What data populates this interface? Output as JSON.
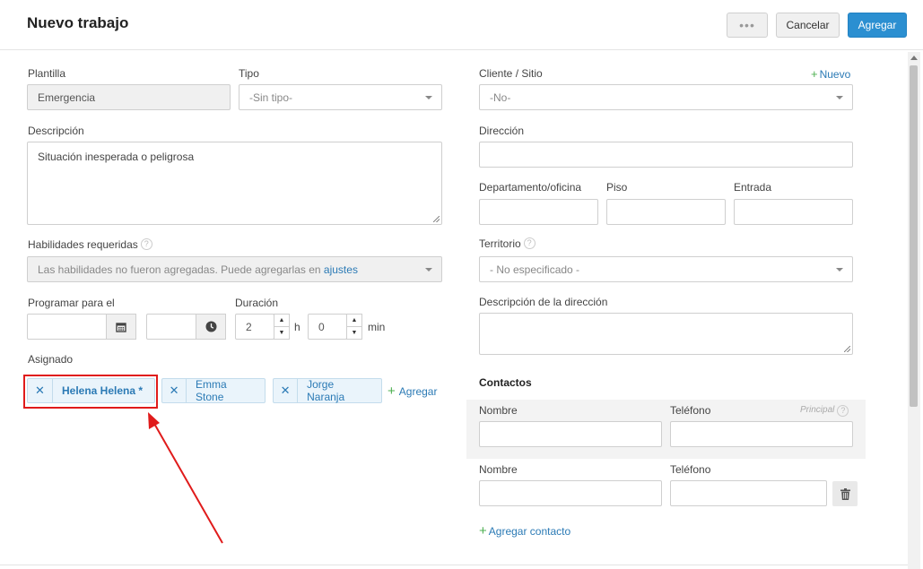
{
  "header": {
    "title": "Nuevo trabajo",
    "more_label": "•••",
    "cancel_label": "Cancelar",
    "add_label": "Agregar"
  },
  "left": {
    "template_label": "Plantilla",
    "template_value": "Emergencia",
    "type_label": "Tipo",
    "type_value": "-Sin tipo-",
    "description_label": "Descripción",
    "description_value": "Situación inesperada o peligrosa",
    "skills_label": "Habilidades requeridas",
    "skills_placeholder": "Las habilidades no fueron agregadas. Puede agregarlas en",
    "skills_link": "ajustes",
    "schedule_label": "Programar para el",
    "duration_label": "Duración",
    "hours_value": "2",
    "hours_unit": "h",
    "minutes_value": "0",
    "minutes_unit": "min",
    "assigned_label": "Asignado",
    "assignees": [
      {
        "name": "Helena Helena *"
      },
      {
        "name": "Emma Stone"
      },
      {
        "name": "Jorge Naranja"
      }
    ],
    "add_assignee_label": "Agregar"
  },
  "right": {
    "client_label": "Cliente / Sitio",
    "new_label": "Nuevo",
    "client_value": "-No-",
    "address_label": "Dirección",
    "department_label": "Departamento/oficina",
    "floor_label": "Piso",
    "entrance_label": "Entrada",
    "territory_label": "Territorio",
    "territory_value": "- No especificado -",
    "address_description_label": "Descripción de la dirección",
    "contacts_title": "Contactos",
    "contacts": [
      {
        "name_label": "Nombre",
        "phone_label": "Teléfono",
        "primary_label": "Principal"
      },
      {
        "name_label": "Nombre",
        "phone_label": "Teléfono"
      }
    ],
    "add_contact_label": "Agregar contacto"
  },
  "colors": {
    "primary": "#2b8fd1",
    "link": "#2b7ab5",
    "add_plus": "#4caf50",
    "annotation": "#e01b1b"
  }
}
